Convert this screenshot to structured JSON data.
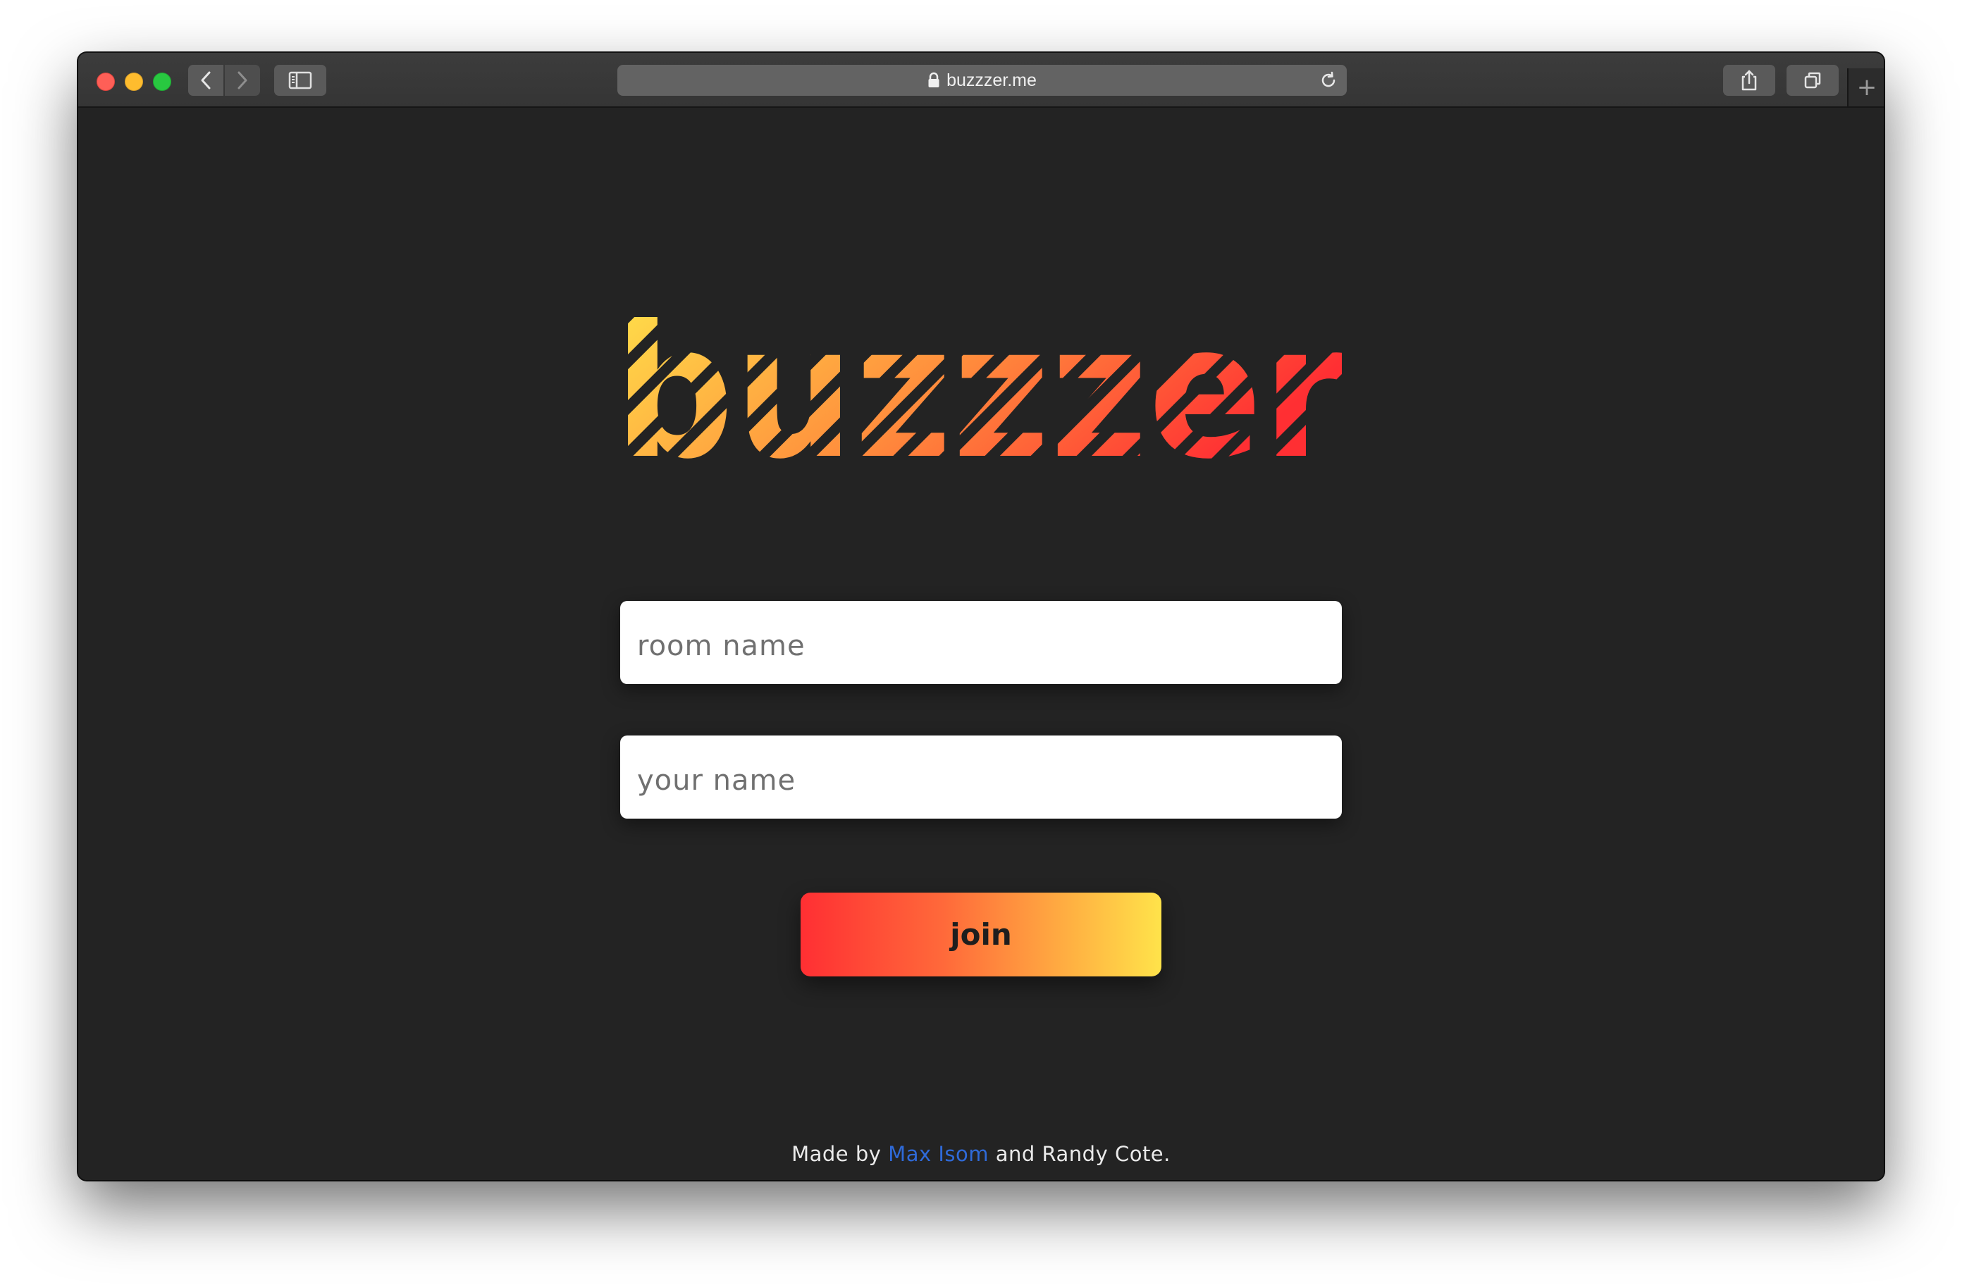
{
  "browser": {
    "url": "buzzzer.me",
    "new_tab_symbol": "+"
  },
  "logo": {
    "text": "buzzzer",
    "gradient_start": "#ffe34a",
    "gradient_end": "#ff2f33",
    "stripe_color": "#232323"
  },
  "form": {
    "room_placeholder": "room name",
    "room_value": "",
    "name_placeholder": "your name",
    "name_value": "",
    "join_label": "join"
  },
  "footer": {
    "prefix": "Made by ",
    "author1": "Max Isom",
    "middle": " and Randy Cote.",
    "link_color": "#2f6ad8"
  },
  "colors": {
    "page_background": "#232323",
    "button_gradient_start": "#ff2f33",
    "button_gradient_end": "#ffe34a"
  }
}
